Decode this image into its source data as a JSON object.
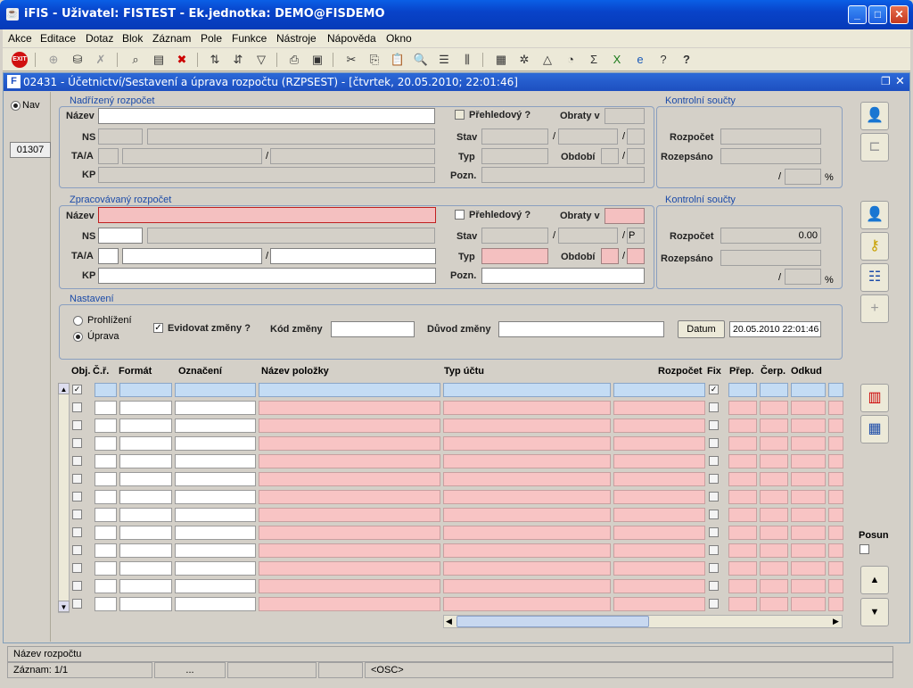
{
  "window": {
    "title": "iFIS - Uživatel: FISTEST - Ek.jednotka: DEMO@FISDEMO"
  },
  "menu": [
    "Akce",
    "Editace",
    "Dotaz",
    "Blok",
    "Záznam",
    "Pole",
    "Funkce",
    "Nástroje",
    "Nápověda",
    "Okno"
  ],
  "inner": {
    "title": "02431 - Účetnictví/Sestavení a úprava rozpočtu (RZPSEST) - [čtvrtek, 20.05.2010; 22:01:46]"
  },
  "nav": {
    "radio_label": "Nav",
    "code": "01307"
  },
  "parent": {
    "group_label": "Nadřízený rozpočet",
    "lbl_nazev": "Název",
    "lbl_ns": "NS",
    "lbl_taa": "TA/A",
    "lbl_kp": "KP",
    "lbl_prehled": "Přehledový ?",
    "lbl_obraty": "Obraty v",
    "lbl_stav": "Stav",
    "lbl_typ": "Typ",
    "lbl_obdobi": "Období",
    "lbl_pozn": "Pozn."
  },
  "parent_ctrl": {
    "group_label": "Kontrolní součty",
    "lbl_rozpocet": "Rozpočet",
    "lbl_rozepsano": "Rozepsáno",
    "pct": "%"
  },
  "work": {
    "group_label": "Zpracovávaný rozpočet",
    "lbl_nazev": "Název",
    "lbl_ns": "NS",
    "lbl_taa": "TA/A",
    "lbl_kp": "KP",
    "lbl_prehled": "Přehledový ?",
    "lbl_obraty": "Obraty v",
    "lbl_stav": "Stav",
    "stav_suffix": "P",
    "lbl_typ": "Typ",
    "lbl_obdobi": "Období",
    "lbl_pozn": "Pozn."
  },
  "work_ctrl": {
    "group_label": "Kontrolní součty",
    "lbl_rozpocet": "Rozpočet",
    "rozpocet_value": "0.00",
    "lbl_rozepsano": "Rozepsáno",
    "pct": "%"
  },
  "settings": {
    "group_label": "Nastavení",
    "radio_prohlizeni": "Prohlížení",
    "radio_uprava": "Úprava",
    "selected": "Úprava",
    "lbl_evidovat": "Evidovat změny ?",
    "evidovat_checked": true,
    "lbl_kod": "Kód změny",
    "lbl_duvod": "Důvod změny",
    "btn_datum": "Datum",
    "datum_value": "20.05.2010 22:01:46"
  },
  "grid": {
    "headers": {
      "obj": "Obj.",
      "cr": "Č.ř.",
      "format": "Formát",
      "oznaceni": "Označení",
      "nazev": "Název položky",
      "typ": "Typ účtu",
      "rozpocet": "Rozpočet",
      "fix": "Fix",
      "prep": "Přep.",
      "cerp": "Čerp.",
      "odkud": "Odkud"
    },
    "rows": 13,
    "first_row_checked": true
  },
  "side": {
    "posun_label": "Posun"
  },
  "status": {
    "hint": "Název rozpočtu",
    "record": "Záznam: 1/1",
    "dots": "...",
    "osc": "<OSC>"
  },
  "colors": {
    "titlebar": "#0843c9",
    "required": "#f4c0c0",
    "selected_row": "#c4dcf4"
  }
}
